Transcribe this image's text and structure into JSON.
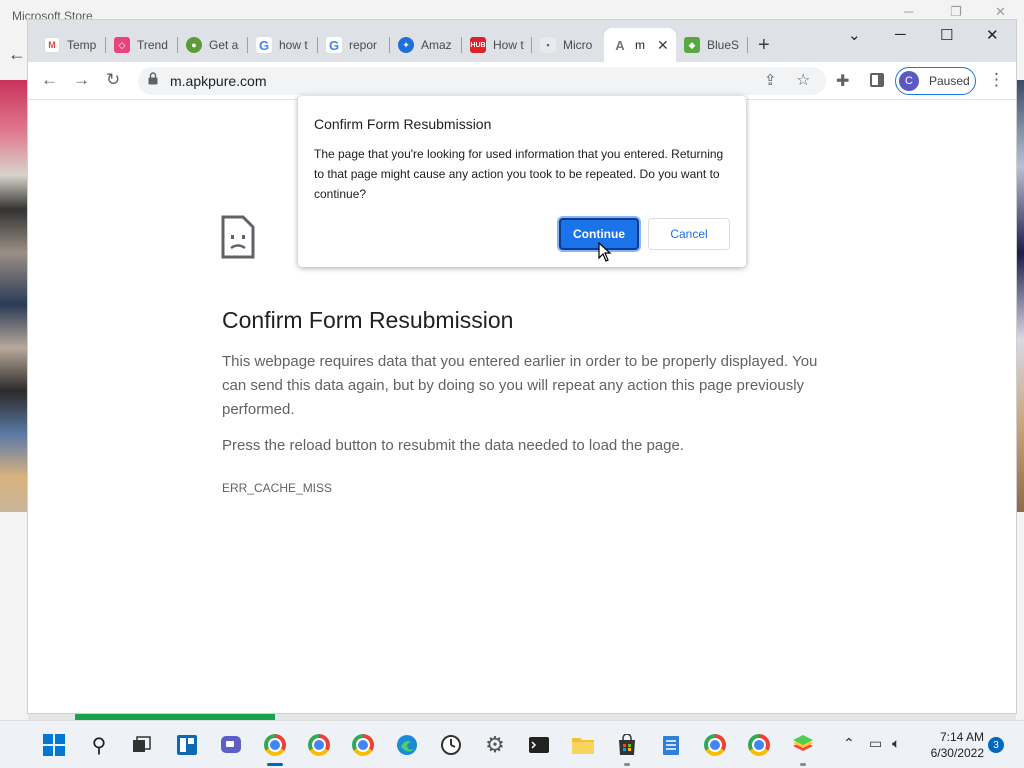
{
  "background_app": {
    "title": "Microsoft Store"
  },
  "browser": {
    "tabs": [
      {
        "label": "Temp",
        "fav_color": "#ea4335",
        "fav_icon": "gmail-icon"
      },
      {
        "label": "Trend",
        "fav_color": "#e8447a",
        "fav_icon": "trends-icon"
      },
      {
        "label": "Get a",
        "fav_color": "#5c9a3a",
        "fav_icon": "wechat-icon"
      },
      {
        "label": "how t",
        "fav_color": "#4285f4",
        "fav_icon": "google-icon"
      },
      {
        "label": "repor",
        "fav_color": "#4285f4",
        "fav_icon": "google-icon"
      },
      {
        "label": "Amaz",
        "fav_color": "#1e6fd9",
        "fav_icon": "amazon-icon"
      },
      {
        "label": "How t",
        "fav_color": "#d9252a",
        "fav_icon": "hub-icon"
      },
      {
        "label": "Micro",
        "fav_color": "#e9eaed",
        "fav_icon": "microsoft-icon"
      },
      {
        "label": "m",
        "fav_color": "#6f7782",
        "fav_icon": "apkpure-icon",
        "active": true
      },
      {
        "label": "BlueS",
        "fav_color": "#57a843",
        "fav_icon": "bluestacks-icon"
      }
    ],
    "url": "m.apkpure.com",
    "profile": {
      "initial": "C",
      "status": "Paused"
    }
  },
  "dialog": {
    "title": "Confirm Form Resubmission",
    "message": "The page that you're looking for used information that you entered. Returning to that page might cause any action you took to be repeated. Do you want to continue?",
    "continue_label": "Continue",
    "cancel_label": "Cancel"
  },
  "error_page": {
    "title": "Confirm Form Resubmission",
    "body": "This webpage requires data that you entered earlier in order to be properly displayed. You can send this data again, but by doing so you will repeat any action this page previously performed.",
    "reload_text": "Press the reload button to resubmit the data needed to load the page.",
    "error_code": "ERR_CACHE_MISS"
  },
  "taskbar": {
    "time": "7:14 AM",
    "date": "6/30/2022",
    "notification_count": "3"
  }
}
